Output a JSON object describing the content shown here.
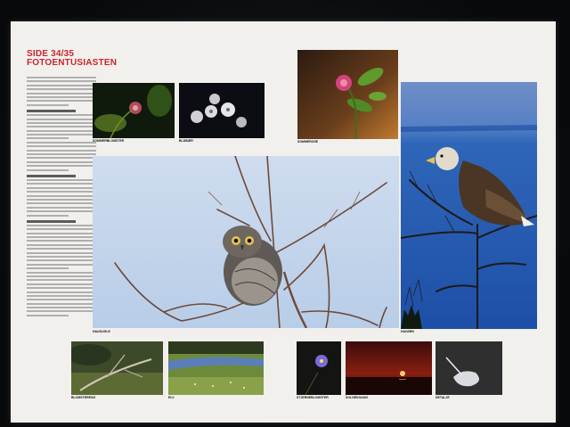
{
  "spread": {
    "title_line1": "SIDE 34/35",
    "title_line2": "FOTOENTUSIASTEN"
  },
  "captions": {
    "top1_label": "SOMMERBLOMSTER",
    "top2_label": "BLÅBÆR",
    "top3_label": "SOMMEROSE",
    "owl_label": "HAUKUGLE",
    "eagle_label": "HAVØRN",
    "b1_label": "BLOMSTERENG",
    "b2_label": "ELV",
    "b3_label": "STJERNEBLOMSTER",
    "b4_label": "SOLNEDGANG",
    "b5_label": "DETALJE"
  },
  "colors": {
    "title_red": "#c8262c",
    "page_bg": "#f1f0ed",
    "sky_blue": "#6f9fe0"
  }
}
